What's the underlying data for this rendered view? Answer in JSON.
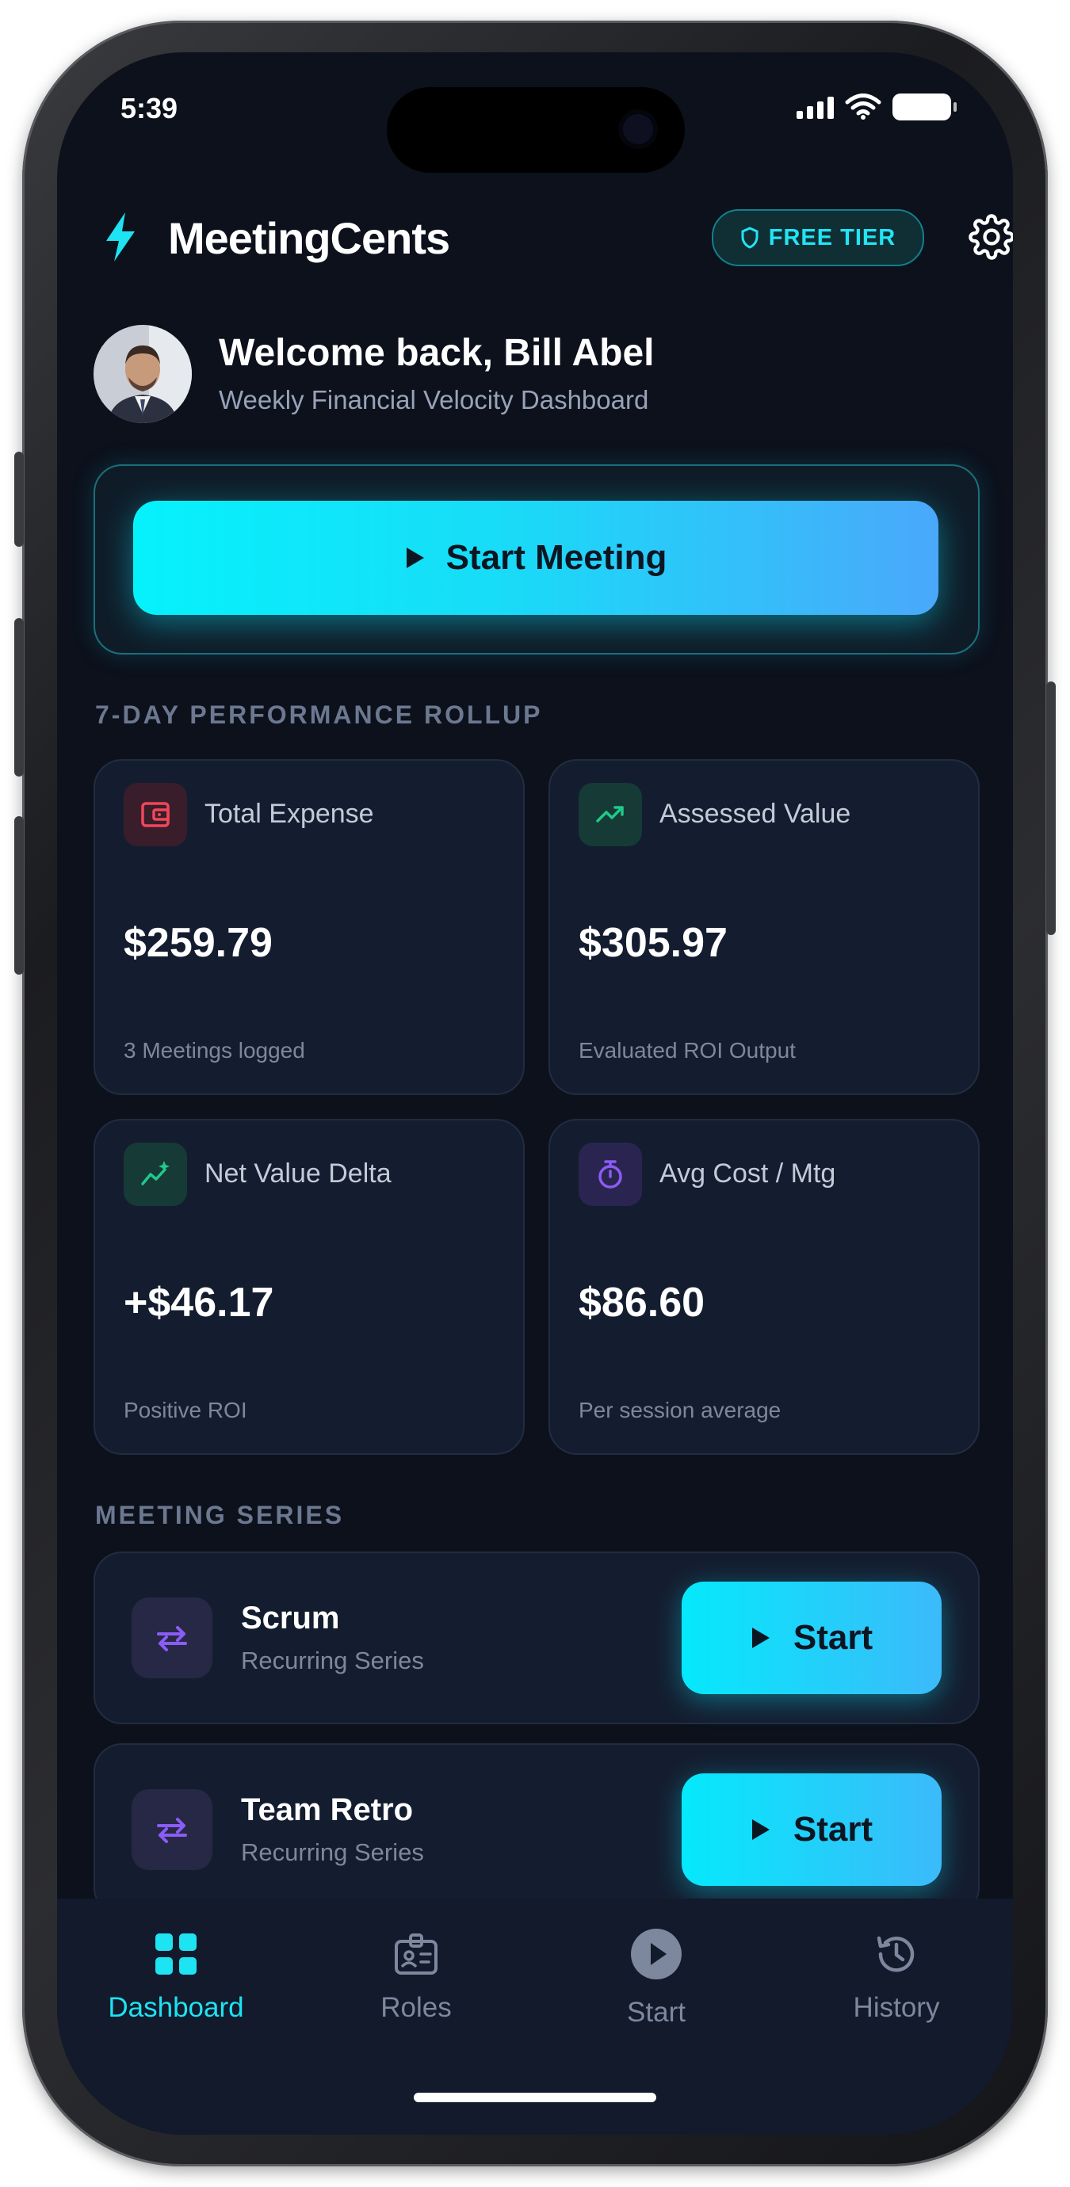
{
  "status_bar": {
    "time": "5:39"
  },
  "header": {
    "app_title": "MeetingCents",
    "tier_badge": "FREE TIER"
  },
  "welcome": {
    "title": "Welcome back, Bill Abel",
    "subtitle": "Weekly Financial Velocity Dashboard"
  },
  "start_meeting": {
    "label": "Start Meeting"
  },
  "rollup": {
    "section_label": "7-DAY PERFORMANCE ROLLUP",
    "cards": [
      {
        "label": "Total Expense",
        "value": "$259.79",
        "foot": "3 Meetings logged",
        "icon": "wallet-icon",
        "color": "#f0475a"
      },
      {
        "label": "Assessed Value",
        "value": "$305.97",
        "foot": "Evaluated ROI Output",
        "icon": "trending-up-icon",
        "color": "#1fc98a"
      },
      {
        "label": "Net Value Delta",
        "value": "+$46.17",
        "foot": "Positive ROI",
        "icon": "sparkle-chart-icon",
        "color": "#1fc98a"
      },
      {
        "label": "Avg Cost / Mtg",
        "value": "$86.60",
        "foot": "Per session average",
        "icon": "stopwatch-icon",
        "color": "#8b5cf6"
      }
    ]
  },
  "series": {
    "section_label": "MEETING SERIES",
    "items": [
      {
        "name": "Scrum",
        "subtitle": "Recurring Series",
        "button": "Start"
      },
      {
        "name": "Team Retro",
        "subtitle": "Recurring Series",
        "button": "Start"
      }
    ]
  },
  "nav": {
    "items": [
      {
        "label": "Dashboard",
        "icon": "grid-icon",
        "active": true
      },
      {
        "label": "Roles",
        "icon": "id-badge-icon",
        "active": false
      },
      {
        "label": "Start",
        "icon": "play-circle-icon",
        "active": false
      },
      {
        "label": "History",
        "icon": "history-icon",
        "active": false
      }
    ]
  },
  "colors": {
    "accent": "#1de3f2",
    "background": "#0c111c",
    "card": "#141d2f"
  }
}
